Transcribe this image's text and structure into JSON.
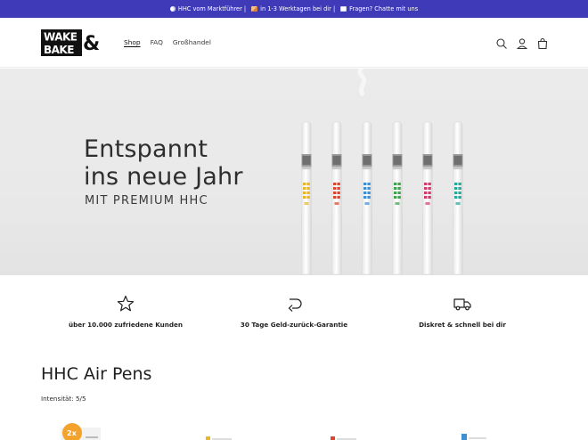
{
  "announcement": {
    "seg1": "HHC vom Marktführer |",
    "seg2": "in 1-3 Werktagen bei dir |",
    "seg3": "Fragen? Chatte mit uns"
  },
  "header": {
    "logo_alt": "WAKE & BAKE",
    "nav": {
      "shop": "Shop",
      "faq": "FAQ",
      "wholesale": "Großhandel"
    }
  },
  "hero": {
    "title_line1": "Entspannt",
    "title_line2": "ins neue Jahr",
    "subtitle": "MIT PREMIUM HHC",
    "pen_colors": [
      "#e9b52b",
      "#d9482e",
      "#3d8fd4",
      "#3fa34d",
      "#d43a6a",
      "#2aa79b"
    ]
  },
  "features": [
    {
      "icon": "star-icon",
      "text": "über 10.000 zufriedene Kunden"
    },
    {
      "icon": "return-arrow-icon",
      "text": "30 Tage Geld-zurück-Garantie"
    },
    {
      "icon": "truck-icon",
      "text": "Diskret & schnell bei dir"
    }
  ],
  "collection": {
    "title": "HHC Air Pens",
    "subtitle": "Intensität: 5/5",
    "badge": "2x"
  }
}
